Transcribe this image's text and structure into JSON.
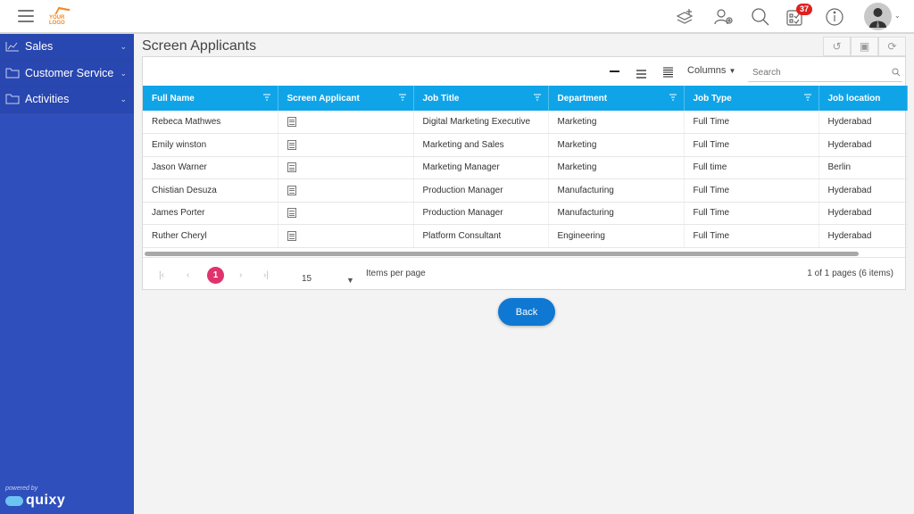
{
  "header": {
    "logo_text": "YOUR LOGO",
    "notification_count": "37",
    "icons": [
      "menu-icon",
      "add-layers-icon",
      "user-settings-icon",
      "search-icon",
      "tasks-icon",
      "info-icon",
      "user-avatar"
    ]
  },
  "sidebar": {
    "items": [
      {
        "label": "Sales",
        "icon": "chart-icon"
      },
      {
        "label": "Customer Service",
        "icon": "folder-icon"
      },
      {
        "label": "Activities",
        "icon": "folder-icon"
      }
    ],
    "powered_by": "powered by",
    "brand": "quixy"
  },
  "page": {
    "title": "Screen Applicants",
    "actions": [
      "undo",
      "save",
      "refresh"
    ]
  },
  "toolbar": {
    "columns_label": "Columns",
    "search_placeholder": "Search"
  },
  "table": {
    "columns": [
      "Full Name",
      "Screen Applicant",
      "Job Title",
      "Department",
      "Job Type",
      "Job location"
    ],
    "rows": [
      {
        "name": "Rebeca Mathwes",
        "title": "Digital Marketing Executive",
        "dept": "Marketing",
        "type": "Full Time",
        "location": "Hyderabad"
      },
      {
        "name": "Emily winston",
        "title": "Marketing and Sales",
        "dept": "Marketing",
        "type": "Full Time",
        "location": "Hyderabad"
      },
      {
        "name": "Jason Warner",
        "title": "Marketing Manager",
        "dept": "Marketing",
        "type": "Full time",
        "location": "Berlin"
      },
      {
        "name": "Chistian Desuza",
        "title": "Production Manager",
        "dept": "Manufacturing",
        "type": "Full Time",
        "location": "Hyderabad"
      },
      {
        "name": "James Porter",
        "title": "Production Manager",
        "dept": "Manufacturing",
        "type": "Full Time",
        "location": "Hyderabad"
      },
      {
        "name": "Ruther Cheryl",
        "title": "Platform Consultant",
        "dept": "Engineering",
        "type": "Full Time",
        "location": "Hyderabad"
      }
    ]
  },
  "pager": {
    "first": "|‹",
    "prev": "‹",
    "current_page": "1",
    "next": "›",
    "last": "›|",
    "page_size": "15",
    "items_per_page_label": "Items per page",
    "info": "1 of 1 pages (6 items)"
  },
  "back_label": "Back",
  "colors": {
    "sidebar": "#2f4fbc",
    "table_header": "#0fa4e8",
    "current_page": "#e0336e",
    "back_button": "#0f78d2",
    "badge": "#e02020"
  }
}
